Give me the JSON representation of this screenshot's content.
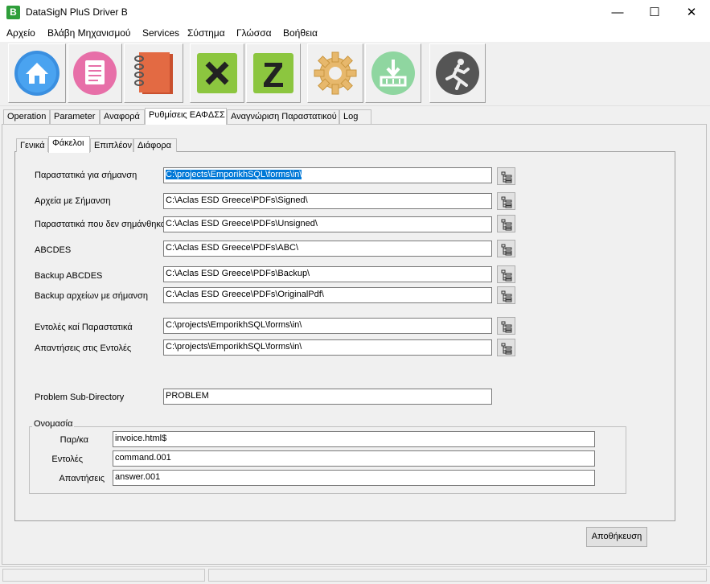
{
  "window": {
    "title": "DataSigN PluS Driver B",
    "app_icon_letter": "B",
    "minimize": "—",
    "maximize": "☐",
    "close": "✕"
  },
  "menu": [
    "Αρχείο",
    "Βλάβη Μηχανισμού",
    "Services",
    "Σύστημα",
    "Γλώσσα",
    "Βοήθεια"
  ],
  "toolbar": [
    {
      "icon": "home-icon"
    },
    {
      "icon": "notepad-icon"
    },
    {
      "icon": "notebook-icon"
    },
    {
      "icon": "x-report-icon"
    },
    {
      "icon": "z-report-icon"
    },
    {
      "icon": "gear-icon"
    },
    {
      "icon": "download-icon"
    },
    {
      "icon": "runner-icon"
    }
  ],
  "tabs": [
    "Operation",
    "Parameter",
    "Αναφορά",
    "Ρυθμίσεις ΕΑΦΔΣΣ",
    "Αναγνώριση Παραστατικού",
    "Log"
  ],
  "active_tab": "Ρυθμίσεις ΕΑΦΔΣΣ",
  "subtabs": [
    "Γενικά",
    "Φάκελοι",
    "Επιπλέον",
    "Διάφορα"
  ],
  "active_subtab": "Φάκελοι",
  "folders": [
    {
      "label": "Παραστατικά για σήμανση",
      "value": "C:\\projects\\EmporikhSQL\\forms\\in\\"
    },
    {
      "label": "Αρχεία με Σήμανση",
      "value": "C:\\Aclas ESD Greece\\PDFs\\Signed\\"
    },
    {
      "label": "Παραστατικά που δεν σημάνθηκαν",
      "value": "C:\\Aclas ESD Greece\\PDFs\\Unsigned\\"
    },
    {
      "label": "ABCDES",
      "value": "C:\\Aclas ESD Greece\\PDFs\\ABC\\"
    },
    {
      "label": "Backup ABCDES",
      "value": "C:\\Aclas ESD Greece\\PDFs\\Backup\\"
    },
    {
      "label": "Backup αρχείων με σήμανση",
      "value": "C:\\Aclas ESD Greece\\PDFs\\OriginalPdf\\"
    },
    {
      "label": "Εντολές καί Παραστατικά",
      "value": "C:\\projects\\EmporikhSQL\\forms\\in\\"
    },
    {
      "label": "Απαντήσεις στις Εντολές",
      "value": "C:\\projects\\EmporikhSQL\\forms\\in\\"
    }
  ],
  "problem": {
    "label": "Problem Sub-Directory",
    "value": "PROBLEM"
  },
  "naming": {
    "title": "Ονομασία",
    "rows": [
      {
        "label": "Παρ/κα",
        "value": "invoice.html$"
      },
      {
        "label": "Εντολές",
        "value": "command.001"
      },
      {
        "label": "Απαντήσεις",
        "value": "answer.001"
      }
    ]
  },
  "save_label": "Αποθήκευση",
  "colors": {
    "selection": "#0078d7",
    "panel": "#f0f0f0"
  }
}
